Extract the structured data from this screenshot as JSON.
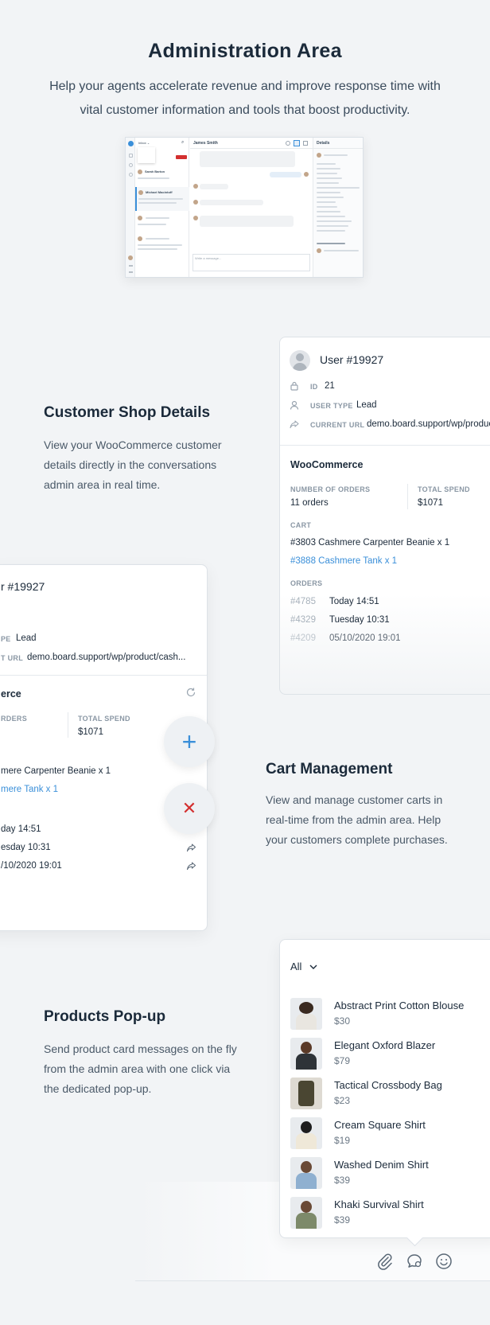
{
  "hero": {
    "title": "Administration Area",
    "subtitle": "Help your agents accelerate revenue and improve response time with vital customer information and tools that boost productivity."
  },
  "mini_screenshot": {
    "conversation_name": "James Smith",
    "details_label": "Details",
    "agent_1": "Sarah Barton",
    "agent_2": "Michael Macintoff",
    "write_placeholder": "Write a message..."
  },
  "shop_details": {
    "title": "Customer Shop Details",
    "text": "View your WooCommerce customer details directly in the conversations admin area in real time."
  },
  "user_card": {
    "name": "User #19927",
    "id_label": "ID",
    "id_value": "21",
    "type_label": "USER TYPE",
    "type_value": "Lead",
    "url_label": "CURRENT URL",
    "url_value": "demo.board.support/wp/produc",
    "woo_title": "WooCommerce",
    "orders_count_label": "NUMBER OF ORDERS",
    "orders_count_value": "11 orders",
    "spend_label": "TOTAL SPEND",
    "spend_value": "$1071",
    "cart_label": "CART",
    "cart_item_1": "#3803 Cashmere Carpenter Beanie x 1",
    "cart_item_2": "#3888 Cashmere Tank x 1",
    "orders_label": "ORDERS",
    "orders": [
      {
        "id": "#4785",
        "date": "Today 14:51"
      },
      {
        "id": "#4329",
        "date": "Tuesday 10:31"
      },
      {
        "id": "#4209",
        "date": "05/10/2020 19:01"
      }
    ]
  },
  "cart_card": {
    "name": "r #19927",
    "type_label": "PE",
    "type_value": "Lead",
    "url_label": "T URL",
    "url_value": "demo.board.support/wp/product/cash...",
    "woo_title": "erce",
    "orders_count_label": "RDERS",
    "spend_label": "TOTAL SPEND",
    "spend_value": "$1071",
    "cart_item_1": "mere Carpenter Beanie x 1",
    "cart_item_2": "mere Tank x 1",
    "orders": [
      "day 14:51",
      "esday 10:31",
      "/10/2020 19:01"
    ]
  },
  "cart_management": {
    "title": "Cart Management",
    "text": "View and manage customer carts in real-time from the admin area. Help your customers complete purchases."
  },
  "buttons": {
    "add_icon": "+",
    "remove_icon": "✕"
  },
  "products_popup": {
    "title": "Products Pop-up",
    "text": "Send product card messages on the fly from the admin area with one click via the dedicated pop-up.",
    "filter_label": "All",
    "products": [
      {
        "name": "Abstract Print Cotton Blouse",
        "price": "$30"
      },
      {
        "name": "Elegant Oxford Blazer",
        "price": "$79"
      },
      {
        "name": "Tactical Crossbody Bag",
        "price": "$23"
      },
      {
        "name": "Cream Square Shirt",
        "price": "$19"
      },
      {
        "name": "Washed Denim Shirt",
        "price": "$39"
      },
      {
        "name": "Khaki Survival Shirt",
        "price": "$39"
      }
    ]
  },
  "colors": {
    "accent": "#3a8fd9",
    "danger": "#d32f2f",
    "background": "#f2f4f6"
  },
  "icons": [
    "lock-icon",
    "user-icon",
    "share-icon",
    "refresh-icon",
    "plus-icon",
    "close-icon",
    "chevron-down-icon",
    "paperclip-icon",
    "chat-product-icon",
    "emoji-icon"
  ]
}
